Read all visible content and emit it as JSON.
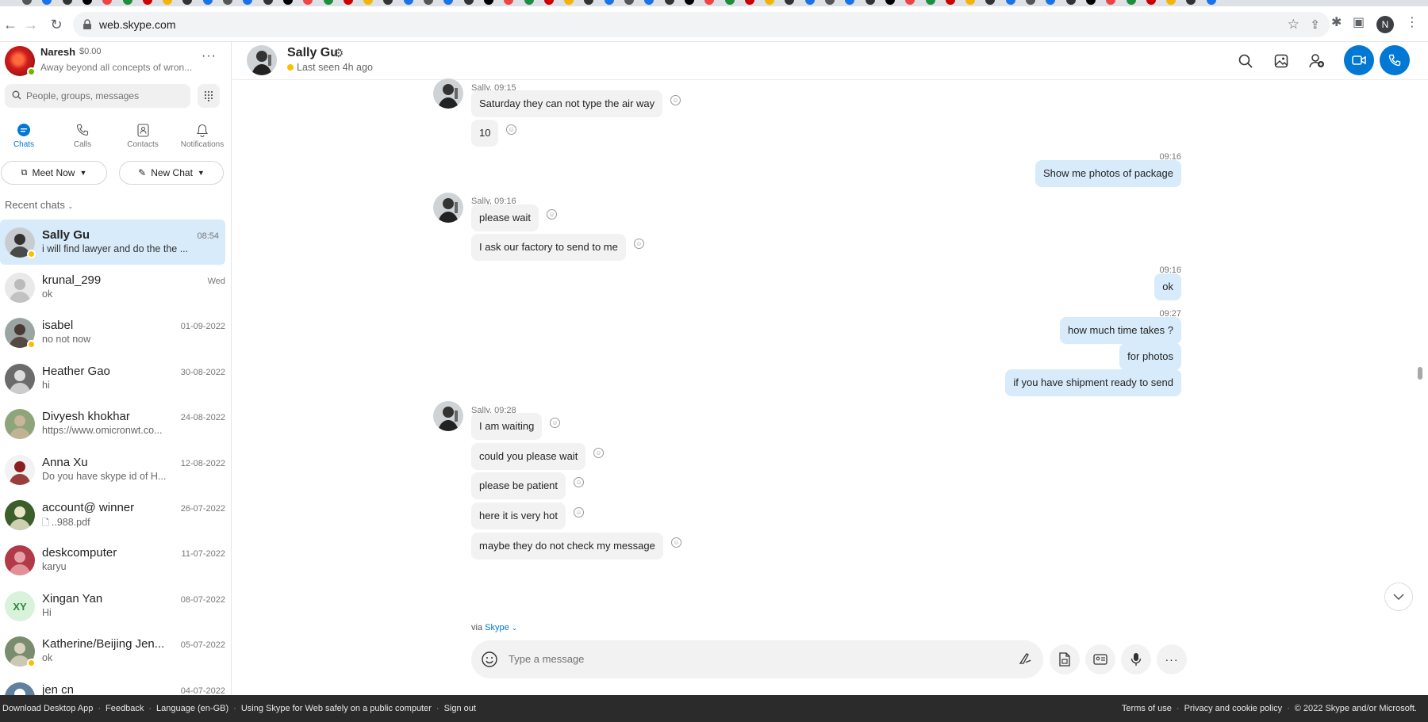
{
  "browser": {
    "url": "web.skype.com",
    "profile_initial": "N"
  },
  "profile": {
    "name": "Naresh",
    "credit": "$0.00",
    "mood": "Away beyond all concepts of wron..."
  },
  "search": {
    "placeholder": "People, groups, messages"
  },
  "nav": [
    {
      "label": "Chats",
      "icon": "chat-icon",
      "active": true
    },
    {
      "label": "Calls",
      "icon": "phone-icon"
    },
    {
      "label": "Contacts",
      "icon": "contacts-icon"
    },
    {
      "label": "Notifications",
      "icon": "bell-icon"
    }
  ],
  "actions": {
    "meet_now": "Meet Now",
    "new_chat": "New Chat"
  },
  "recent_label": "Recent chats",
  "chats": [
    {
      "name": "Sally Gu",
      "preview": "i will find lawyer and do the the ...",
      "date": "08:54",
      "active": true,
      "presence": "away"
    },
    {
      "name": "krunal_299",
      "preview": "ok",
      "date": "Wed"
    },
    {
      "name": "isabel",
      "preview": "no not now",
      "date": "01-09-2022",
      "presence": "away"
    },
    {
      "name": "Heather Gao",
      "preview": "hi",
      "date": "30-08-2022"
    },
    {
      "name": "Divyesh khokhar",
      "preview": "https://www.omicronwt.co...",
      "date": "24-08-2022"
    },
    {
      "name": "Anna Xu",
      "preview": "Do you have skype id of H...",
      "date": "12-08-2022"
    },
    {
      "name": "account@ winner",
      "preview": "..988.pdf",
      "date": "26-07-2022"
    },
    {
      "name": "deskcomputer",
      "preview": "karyu",
      "date": "11-07-2022"
    },
    {
      "name": "Xingan  Yan",
      "preview": "Hi",
      "date": "08-07-2022",
      "initials": "XY"
    },
    {
      "name": "Katherine/Beijing Jen...",
      "preview": "ok",
      "date": "05-07-2022",
      "presence": "away"
    },
    {
      "name": "jen cn",
      "preview": "",
      "date": "04-07-2022"
    }
  ],
  "conversation": {
    "name": "Sally Gu",
    "status": "Last seen 4h ago",
    "groups": [
      {
        "side": "in",
        "meta": "Sally, 09:15",
        "messages": [
          "Saturday they can not type the air way",
          "10"
        ]
      },
      {
        "side": "out",
        "meta": "09:16",
        "messages": [
          "Show me photos of package"
        ]
      },
      {
        "side": "in",
        "meta": "Sally, 09:16",
        "messages": [
          "please wait",
          "I ask our factory to send to me"
        ]
      },
      {
        "side": "out",
        "meta": "09:16",
        "messages": [
          "ok"
        ]
      },
      {
        "side": "out",
        "meta": "09:27",
        "messages": [
          "how much time takes ?",
          "for photos",
          "if you have shipment ready to send"
        ]
      },
      {
        "side": "in",
        "meta": "Sally, 09:28",
        "messages": [
          "I am waiting",
          "could you please wait",
          "please be patient",
          "here it is very hot",
          "maybe they do not check my message"
        ]
      }
    ],
    "via_prefix": "via",
    "via_app": "Skype",
    "composer_placeholder": "Type a message"
  },
  "footer": {
    "left": [
      "Download Desktop App",
      "Feedback",
      "Language (en-GB)",
      "Using Skype for Web safely on a public computer",
      "Sign out"
    ],
    "right": [
      "Terms of use",
      "Privacy and cookie policy",
      "© 2022 Skype and/or Microsoft."
    ]
  },
  "colors": {
    "accent": "#0078d4",
    "active_chat": "#d8ebfa",
    "away": "#f8c000",
    "online": "#6bb700",
    "footer": "#2b2b2b"
  }
}
